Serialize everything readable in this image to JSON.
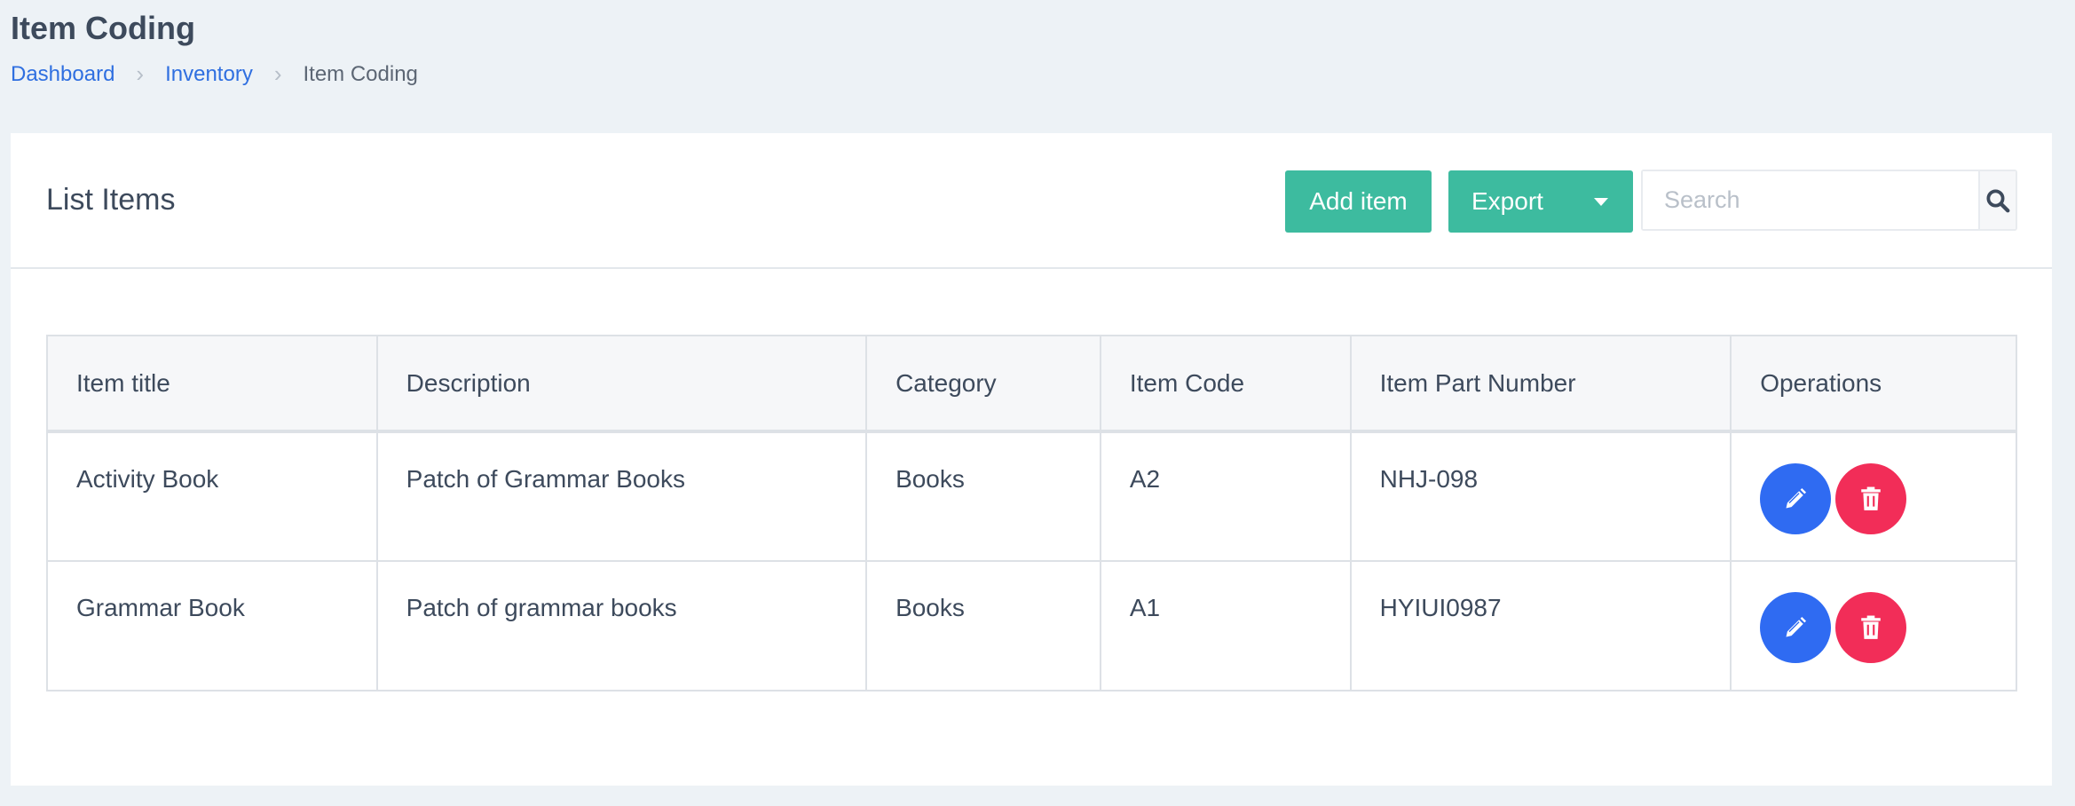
{
  "page": {
    "title": "Item Coding",
    "breadcrumb": [
      {
        "label": "Dashboard"
      },
      {
        "label": "Inventory"
      },
      {
        "label": "Item Coding"
      }
    ]
  },
  "card": {
    "title": "List Items",
    "add_label": "Add item",
    "export_label": "Export",
    "search_placeholder": "Search"
  },
  "table": {
    "headers": [
      "Item title",
      "Description",
      "Category",
      "Item Code",
      "Item Part Number",
      "Operations"
    ],
    "rows": [
      [
        "Activity Book",
        "Patch of Grammar Books",
        "Books",
        "A2",
        "NHJ-098"
      ],
      [
        "Grammar Book",
        "Patch of grammar books",
        "Books",
        "A1",
        "HYIUI0987"
      ]
    ]
  },
  "icons": {
    "breadcrumb_separator": "chevron-right-icon",
    "export_caret": "caret-down-icon",
    "search": "search-icon",
    "edit": "pencil-icon",
    "delete": "trash-icon"
  },
  "colors": {
    "primary_green": "#3dbb9f",
    "edit_blue": "#2f6bf2",
    "delete_red": "#f22d58",
    "link_blue": "#2f6fe0"
  }
}
